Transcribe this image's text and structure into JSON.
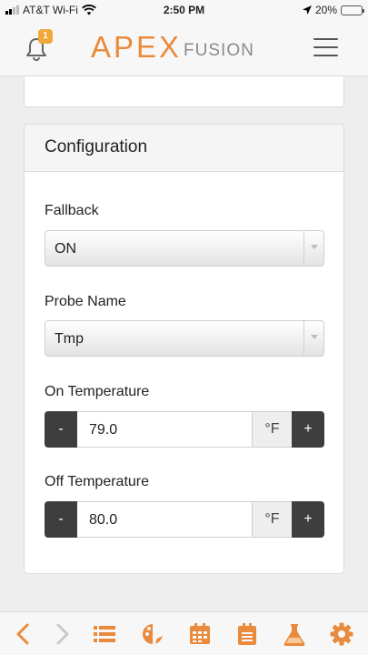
{
  "status_bar": {
    "carrier": "AT&T Wi-Fi",
    "time": "2:50 PM",
    "battery": "20%"
  },
  "header": {
    "notification_count": "1",
    "logo_main": "APEX",
    "logo_sub": "FUSION"
  },
  "panel": {
    "title": "Configuration",
    "fallback": {
      "label": "Fallback",
      "value": "ON"
    },
    "probe_name": {
      "label": "Probe Name",
      "value": "Tmp"
    },
    "on_temperature": {
      "label": "On Temperature",
      "value": "79.0",
      "unit": "°F",
      "minus": "-",
      "plus": "+"
    },
    "off_temperature": {
      "label": "Off Temperature",
      "value": "80.0",
      "unit": "°F",
      "minus": "-",
      "plus": "+"
    }
  },
  "toolbar": {
    "accent": "#e98a3c",
    "icons": [
      "back-icon",
      "forward-icon",
      "list-icon",
      "dashboard-icon",
      "calendar-icon",
      "log-icon",
      "lab-icon",
      "settings-icon"
    ]
  }
}
